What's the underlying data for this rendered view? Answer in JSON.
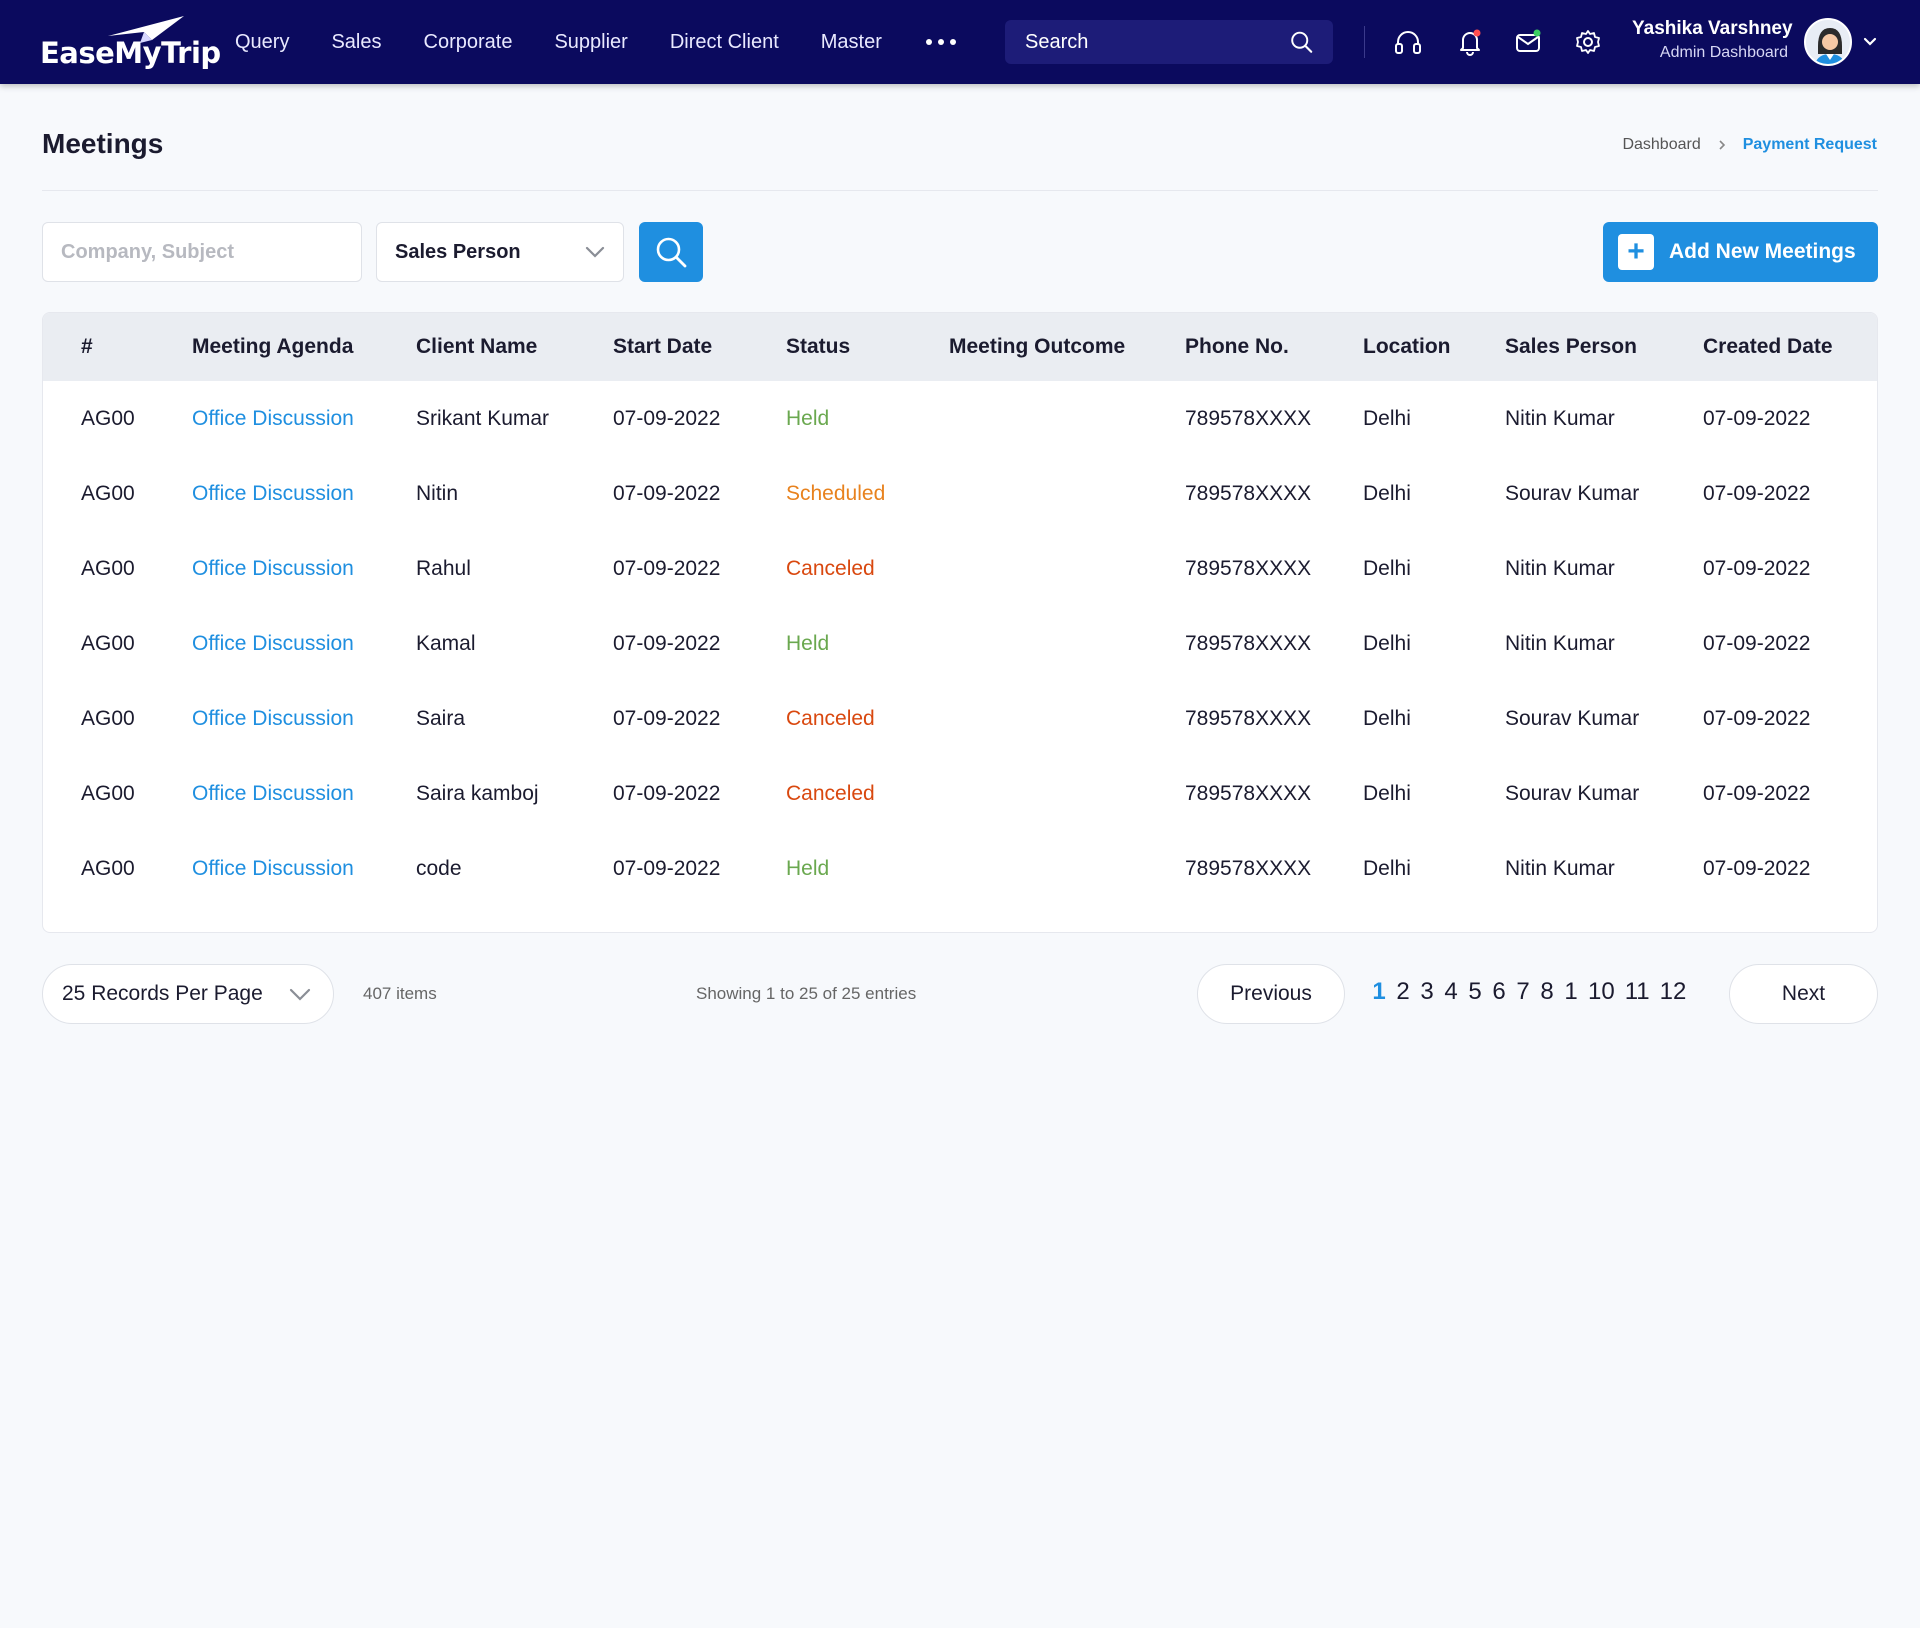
{
  "app": {
    "logo_text": "EaseMyTrip",
    "nav": [
      "Query",
      "Sales",
      "Corporate",
      "Supplier",
      "Direct Client",
      "Master"
    ],
    "search_placeholder": "Search",
    "user": {
      "name": "Yashika Varshney",
      "role": "Admin Dashboard"
    }
  },
  "page": {
    "title": "Meetings",
    "breadcrumb": [
      "Dashboard",
      "Payment Request"
    ]
  },
  "filters": {
    "company_placeholder": "Company, Subject",
    "sales_person_label": "Sales Person",
    "add_button": "Add New Meetings"
  },
  "table": {
    "columns": [
      "#",
      "Meeting Agenda",
      "Client Name",
      "Start Date",
      "Status",
      "Meeting Outcome",
      "Phone No.",
      "Location",
      "Sales Person",
      "Created Date"
    ],
    "rows": [
      {
        "id": "AG00",
        "agenda": "Office Discussion",
        "client": "Srikant Kumar",
        "start": "07-09-2022",
        "status": "Held",
        "outcome": "",
        "phone": "789578XXXX",
        "location": "Delhi",
        "sales": "Nitin Kumar",
        "created": "07-09-2022"
      },
      {
        "id": "AG00",
        "agenda": "Office Discussion",
        "client": "Nitin",
        "start": "07-09-2022",
        "status": "Scheduled",
        "outcome": "",
        "phone": "789578XXXX",
        "location": "Delhi",
        "sales": "Sourav Kumar",
        "created": "07-09-2022"
      },
      {
        "id": "AG00",
        "agenda": "Office Discussion",
        "client": "Rahul",
        "start": "07-09-2022",
        "status": "Canceled",
        "outcome": "",
        "phone": "789578XXXX",
        "location": "Delhi",
        "sales": "Nitin Kumar",
        "created": "07-09-2022"
      },
      {
        "id": "AG00",
        "agenda": "Office Discussion",
        "client": "Kamal",
        "start": "07-09-2022",
        "status": "Held",
        "outcome": "",
        "phone": "789578XXXX",
        "location": "Delhi",
        "sales": "Nitin Kumar",
        "created": "07-09-2022"
      },
      {
        "id": "AG00",
        "agenda": "Office Discussion",
        "client": "Saira",
        "start": "07-09-2022",
        "status": "Canceled",
        "outcome": "",
        "phone": "789578XXXX",
        "location": "Delhi",
        "sales": "Sourav Kumar",
        "created": "07-09-2022"
      },
      {
        "id": "AG00",
        "agenda": "Office Discussion",
        "client": "Saira kamboj",
        "start": "07-09-2022",
        "status": "Canceled",
        "outcome": "",
        "phone": "789578XXXX",
        "location": "Delhi",
        "sales": "Sourav Kumar",
        "created": "07-09-2022"
      },
      {
        "id": "AG00",
        "agenda": "Office Discussion",
        "client": "code",
        "start": "07-09-2022",
        "status": "Held",
        "outcome": "",
        "phone": "789578XXXX",
        "location": "Delhi",
        "sales": "Nitin Kumar",
        "created": "07-09-2022"
      }
    ]
  },
  "status_colors": {
    "Held": "#6aa84f",
    "Scheduled": "#e8821e",
    "Canceled": "#d9480f"
  },
  "colors": {
    "nav_bg": "#0b0a5e",
    "accent": "#1f8fe0"
  },
  "pagination": {
    "records_per_page": "25 Records Per Page",
    "items": "407 items",
    "showing": "Showing 1 to 25 of 25 entries",
    "previous": "Previous",
    "next": "Next",
    "pages": [
      "1",
      "2",
      "3",
      "4",
      "5",
      "6",
      "7",
      "8",
      "1",
      "10",
      "11",
      "12"
    ],
    "active": "1"
  },
  "icons": [
    "search-icon",
    "headset-icon",
    "bell-icon",
    "mail-icon",
    "gear-icon",
    "chevron-down-icon",
    "plus-icon"
  ]
}
